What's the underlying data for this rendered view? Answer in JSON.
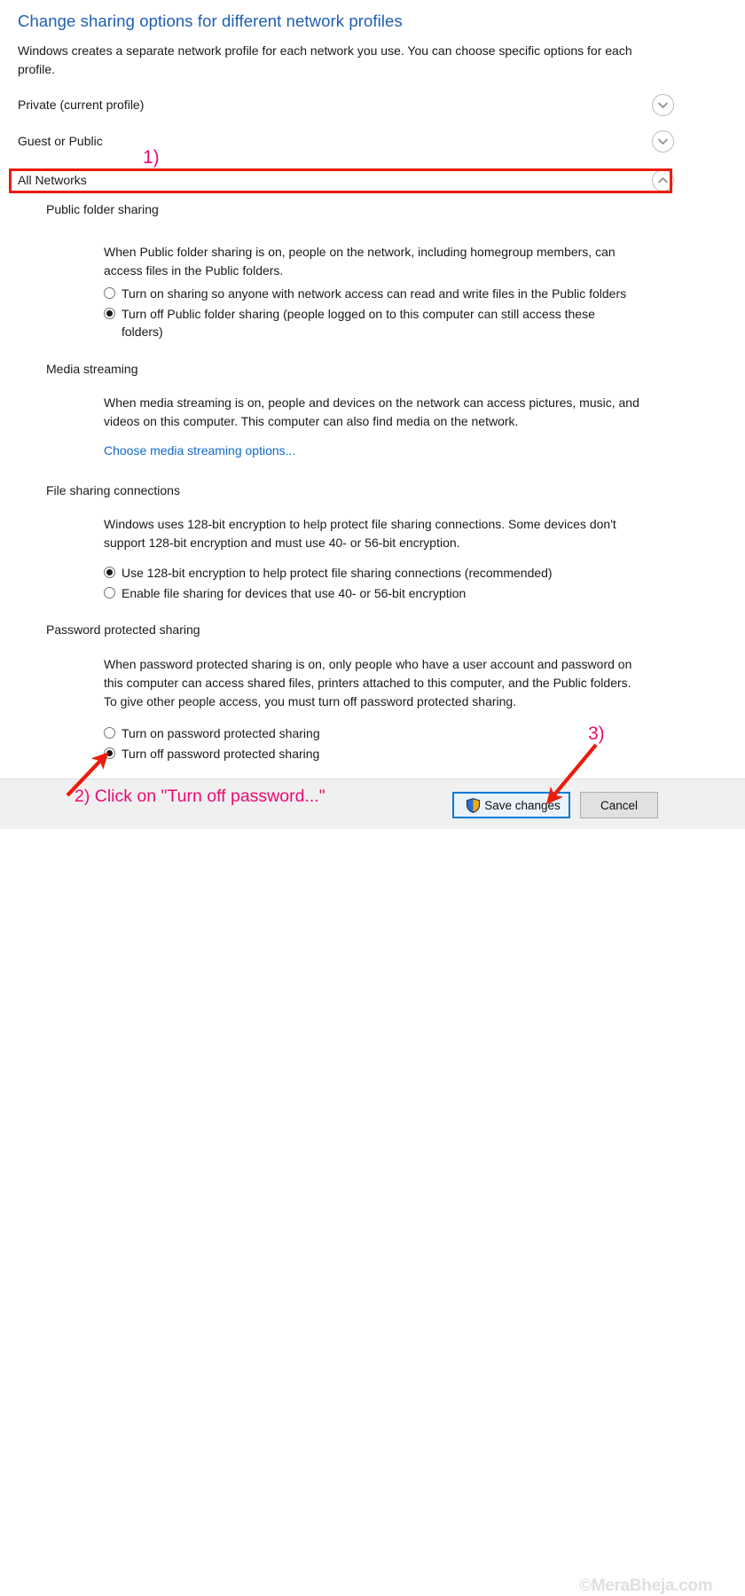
{
  "page": {
    "title": "Change sharing options for different network profiles",
    "intro": "Windows creates a separate network profile for each network you use. You can choose specific options for each profile."
  },
  "profiles": [
    {
      "label": "Private (current profile)",
      "icon": "chevron-down-icon",
      "expanded": false
    },
    {
      "label": "Guest or Public",
      "icon": "chevron-down-icon",
      "expanded": false
    },
    {
      "label": "All Networks",
      "icon": "chevron-up-icon",
      "expanded": true
    }
  ],
  "sections": {
    "public_folder_sharing": {
      "heading": "Public folder sharing",
      "description": "When Public folder sharing is on, people on the network, including homegroup members, can access files in the Public folders.",
      "options": [
        {
          "label": "Turn on sharing so anyone with network access can read and write files in the Public folders",
          "checked": false
        },
        {
          "label": "Turn off Public folder sharing (people logged on to this computer can still access these folders)",
          "checked": true
        }
      ]
    },
    "media_streaming": {
      "heading": "Media streaming",
      "description": "When media streaming is on, people and devices on the network can access pictures, music, and videos on this computer. This computer can also find media on the network.",
      "link_label": "Choose media streaming options..."
    },
    "file_sharing_connections": {
      "heading": "File sharing connections",
      "description": "Windows uses 128-bit encryption to help protect file sharing connections. Some devices don't support 128-bit encryption and must use 40- or 56-bit encryption.",
      "options": [
        {
          "label": "Use 128-bit encryption to help protect file sharing connections (recommended)",
          "checked": true
        },
        {
          "label": "Enable file sharing for devices that use 40- or 56-bit encryption",
          "checked": false
        }
      ]
    },
    "password_protected_sharing": {
      "heading": "Password protected sharing",
      "description": "When password protected sharing is on, only people who have a user account and password on this computer can access shared files, printers attached to this computer, and the Public folders. To give other people access, you must turn off password protected sharing.",
      "options": [
        {
          "label": "Turn on password protected sharing",
          "checked": false
        },
        {
          "label": "Turn off password protected sharing",
          "checked": true
        }
      ]
    }
  },
  "command_bar": {
    "save_label": "Save changes",
    "save_icon": "uac-shield-icon",
    "cancel_label": "Cancel"
  },
  "watermark": {
    "text": "©MeraBheja.com"
  },
  "annotations": {
    "step1": "1)",
    "step2": "2) Click on \"Turn off password...\"",
    "step3": "3)"
  },
  "colors": {
    "title_blue": "#1f5fb0",
    "link_blue": "#1069c9",
    "annotation_pink": "#ec0a74",
    "annotation_red": "#ec1c0c",
    "focus_blue": "#0078d7"
  }
}
